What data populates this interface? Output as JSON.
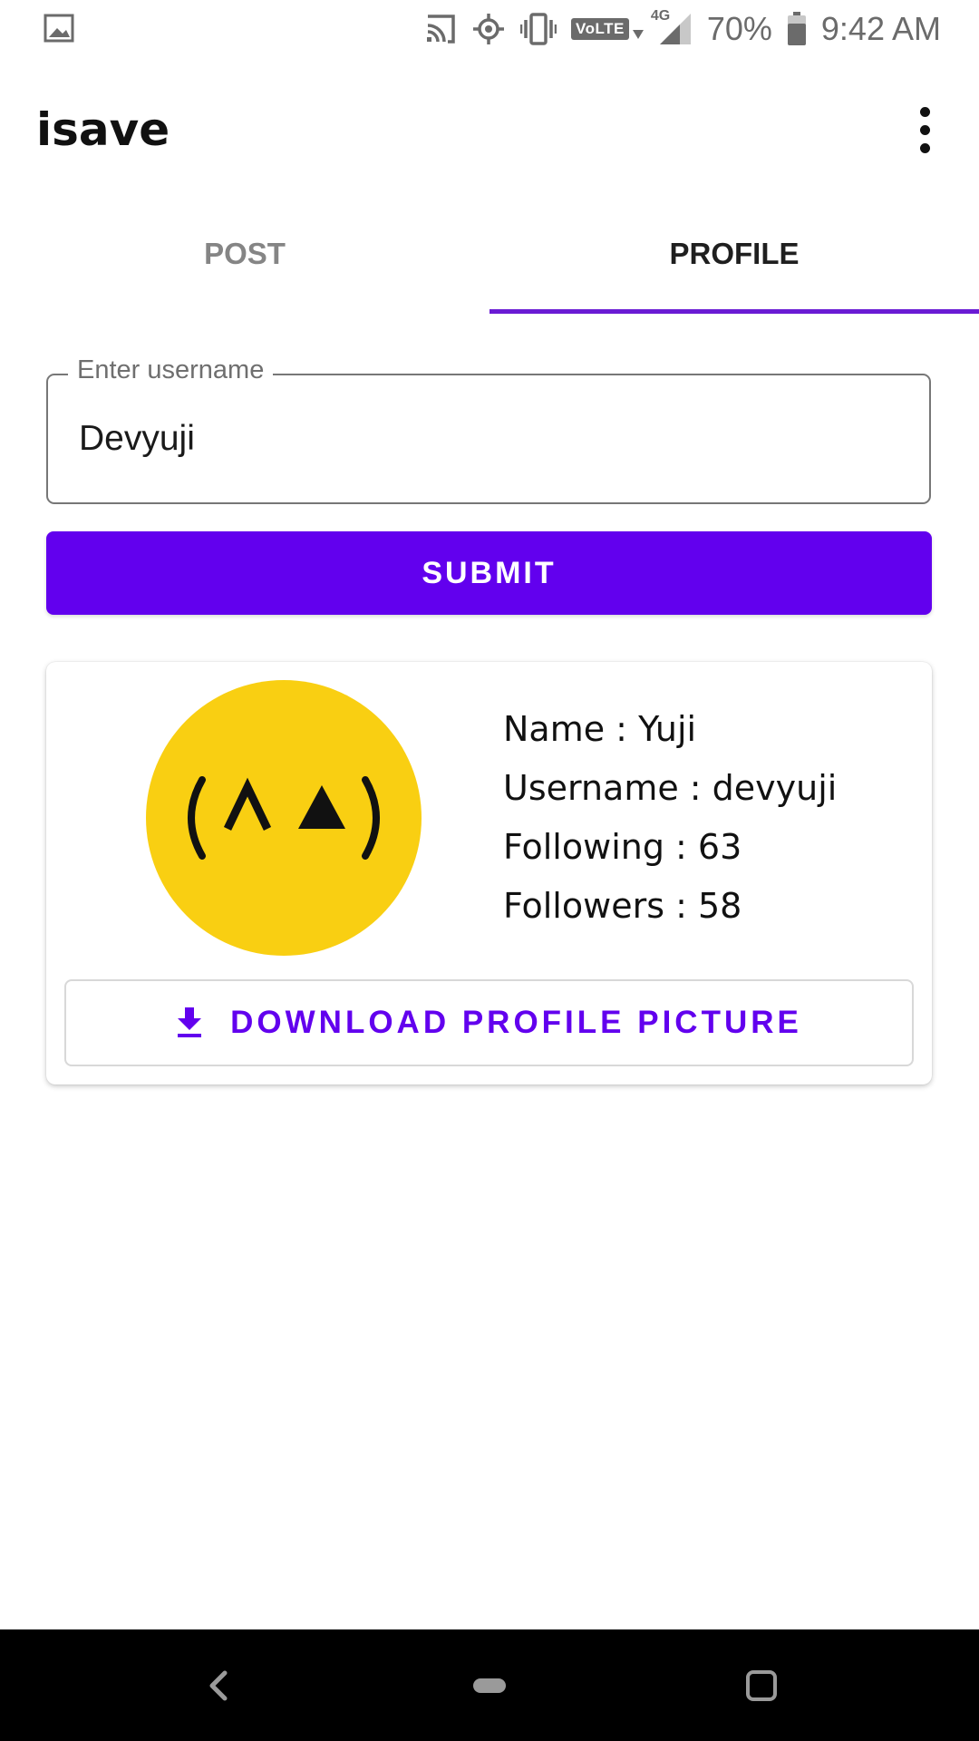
{
  "status_bar": {
    "battery": "70%",
    "time": "9:42 AM",
    "volte": "VoLTE",
    "network": "4G",
    "icons": [
      "image-icon",
      "cast-icon",
      "location-icon",
      "vibrate-icon",
      "volte-icon",
      "signal-icon",
      "battery-icon"
    ]
  },
  "app_bar": {
    "title": "isave",
    "menu_icon": "more-vert-icon"
  },
  "tabs": [
    {
      "label": "POST",
      "active": false
    },
    {
      "label": "PROFILE",
      "active": true
    }
  ],
  "search": {
    "label": "Enter username",
    "value": "Devyuji"
  },
  "submit": {
    "label": "SUBMIT"
  },
  "profile": {
    "avatar_text": "(^▲)",
    "name": "Name : Yuji",
    "username": "Username : devyuji",
    "following": "Following : 63",
    "followers": "Followers : 58",
    "download_label": "DOWNLOAD PROFILE PICTURE",
    "download_icon": "download-icon"
  },
  "nav_bar": {
    "buttons": [
      "back-icon",
      "home-icon",
      "recents-icon"
    ]
  },
  "colors": {
    "accent": "#6200ee",
    "tab_indicator": "#6a1bd4",
    "avatar_bg": "#f9cf12",
    "nav_bg": "#000000"
  }
}
